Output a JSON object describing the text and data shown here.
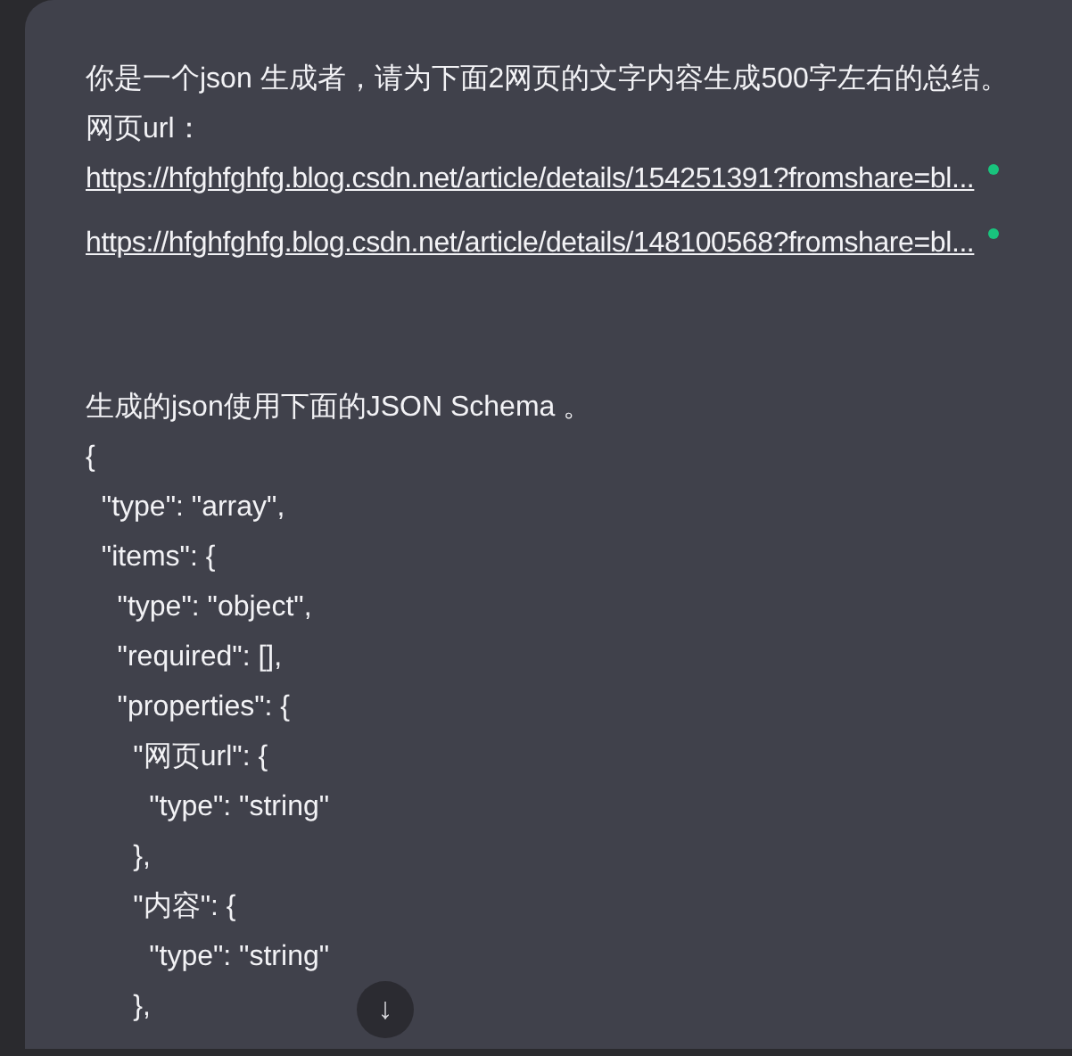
{
  "message": {
    "intro": "你是一个json 生成者，请为下面2网页的文字内容生成500字左右的总结。",
    "url_label": "网页url：",
    "links": [
      {
        "text": "https://hfghfghfg.blog.csdn.net/article/details/154251391?fromshare=bl..."
      },
      {
        "text": "https://hfghfghfg.blog.csdn.net/article/details/148100568?fromshare=bl..."
      }
    ],
    "schema_intro": "生成的json使用下面的JSON Schema 。",
    "code_lines": [
      "{",
      "  \"type\": \"array\",",
      "  \"items\": {",
      "    \"type\": \"object\",",
      "    \"required\": [],",
      "    \"properties\": {",
      "      \"网页url\": {",
      "        \"type\": \"string\"",
      "      },",
      "      \"内容\": {",
      "        \"type\": \"string\"",
      "      },"
    ]
  },
  "scroll_button": {
    "label": "↓"
  }
}
